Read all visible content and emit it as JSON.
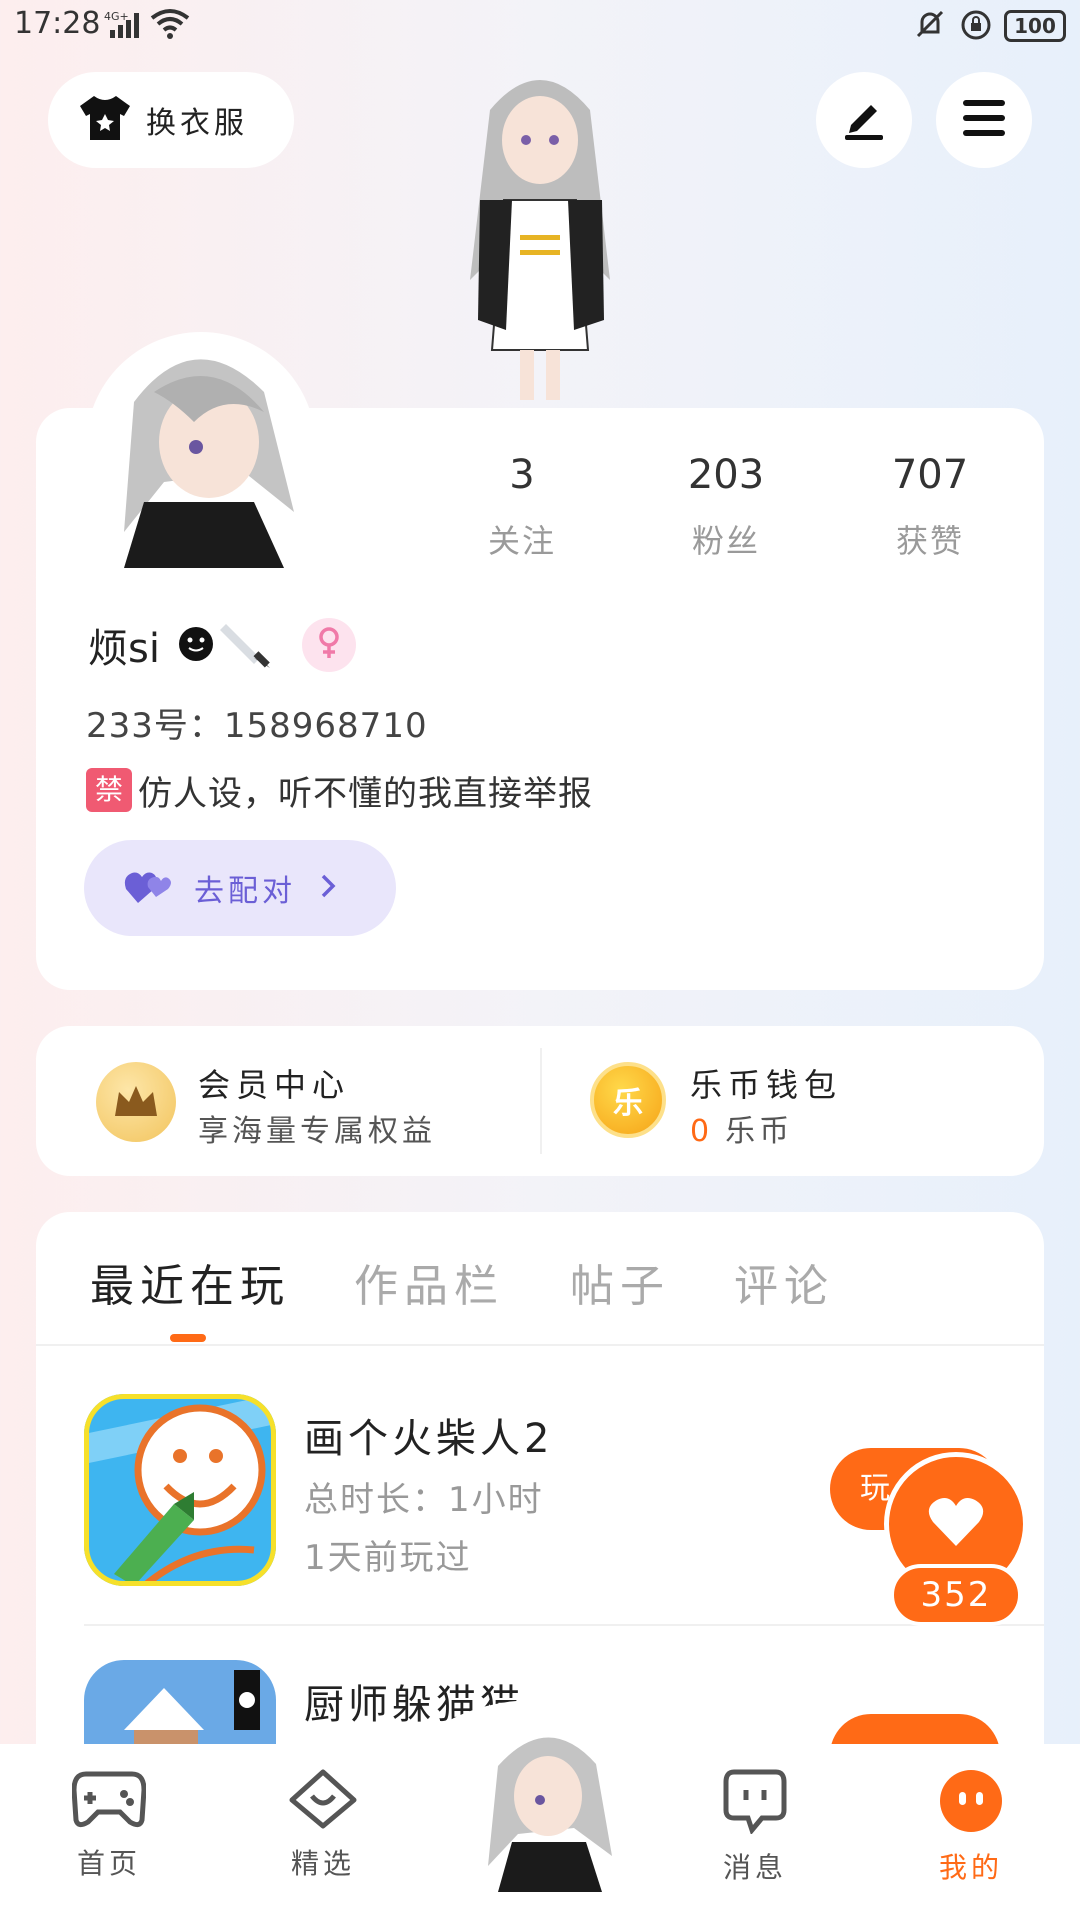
{
  "status_bar": {
    "time": "17:28",
    "network": "4G+",
    "battery": "100"
  },
  "header": {
    "dress_up_label": "换衣服"
  },
  "profile": {
    "stats": [
      {
        "value": "3",
        "label": "关注"
      },
      {
        "value": "203",
        "label": "粉丝"
      },
      {
        "value": "707",
        "label": "获赞"
      }
    ],
    "username": "烦si",
    "user_id": "233号：158968710",
    "bio_tag": "禁",
    "bio": "仿人设，听不懂的我直接举报",
    "pair_label": "去配对"
  },
  "member": {
    "title": "会员中心",
    "subtitle": "享海量专属权益"
  },
  "wallet": {
    "title": "乐币钱包",
    "amount": "0",
    "unit": "乐币",
    "coin_glyph": "乐"
  },
  "tabs": [
    {
      "label": "最近在玩",
      "active": true
    },
    {
      "label": "作品栏",
      "active": false
    },
    {
      "label": "帖子",
      "active": false
    },
    {
      "label": "评论",
      "active": false
    }
  ],
  "games": [
    {
      "title": "画个火柴人2",
      "total_time": "总时长：1小时",
      "last_played": "1天前玩过",
      "play_label": "玩"
    },
    {
      "title": "厨师躲猫猫"
    }
  ],
  "like": {
    "count": "352"
  },
  "bottom_nav": [
    {
      "label": "首页",
      "active": false
    },
    {
      "label": "精选",
      "active": false
    },
    {
      "label": "消息",
      "active": false
    },
    {
      "label": "我的",
      "active": true
    }
  ],
  "colors": {
    "accent": "#ff6a16",
    "pair_purple": "#6b5fd6",
    "gender_pink": "#f07aa8"
  }
}
